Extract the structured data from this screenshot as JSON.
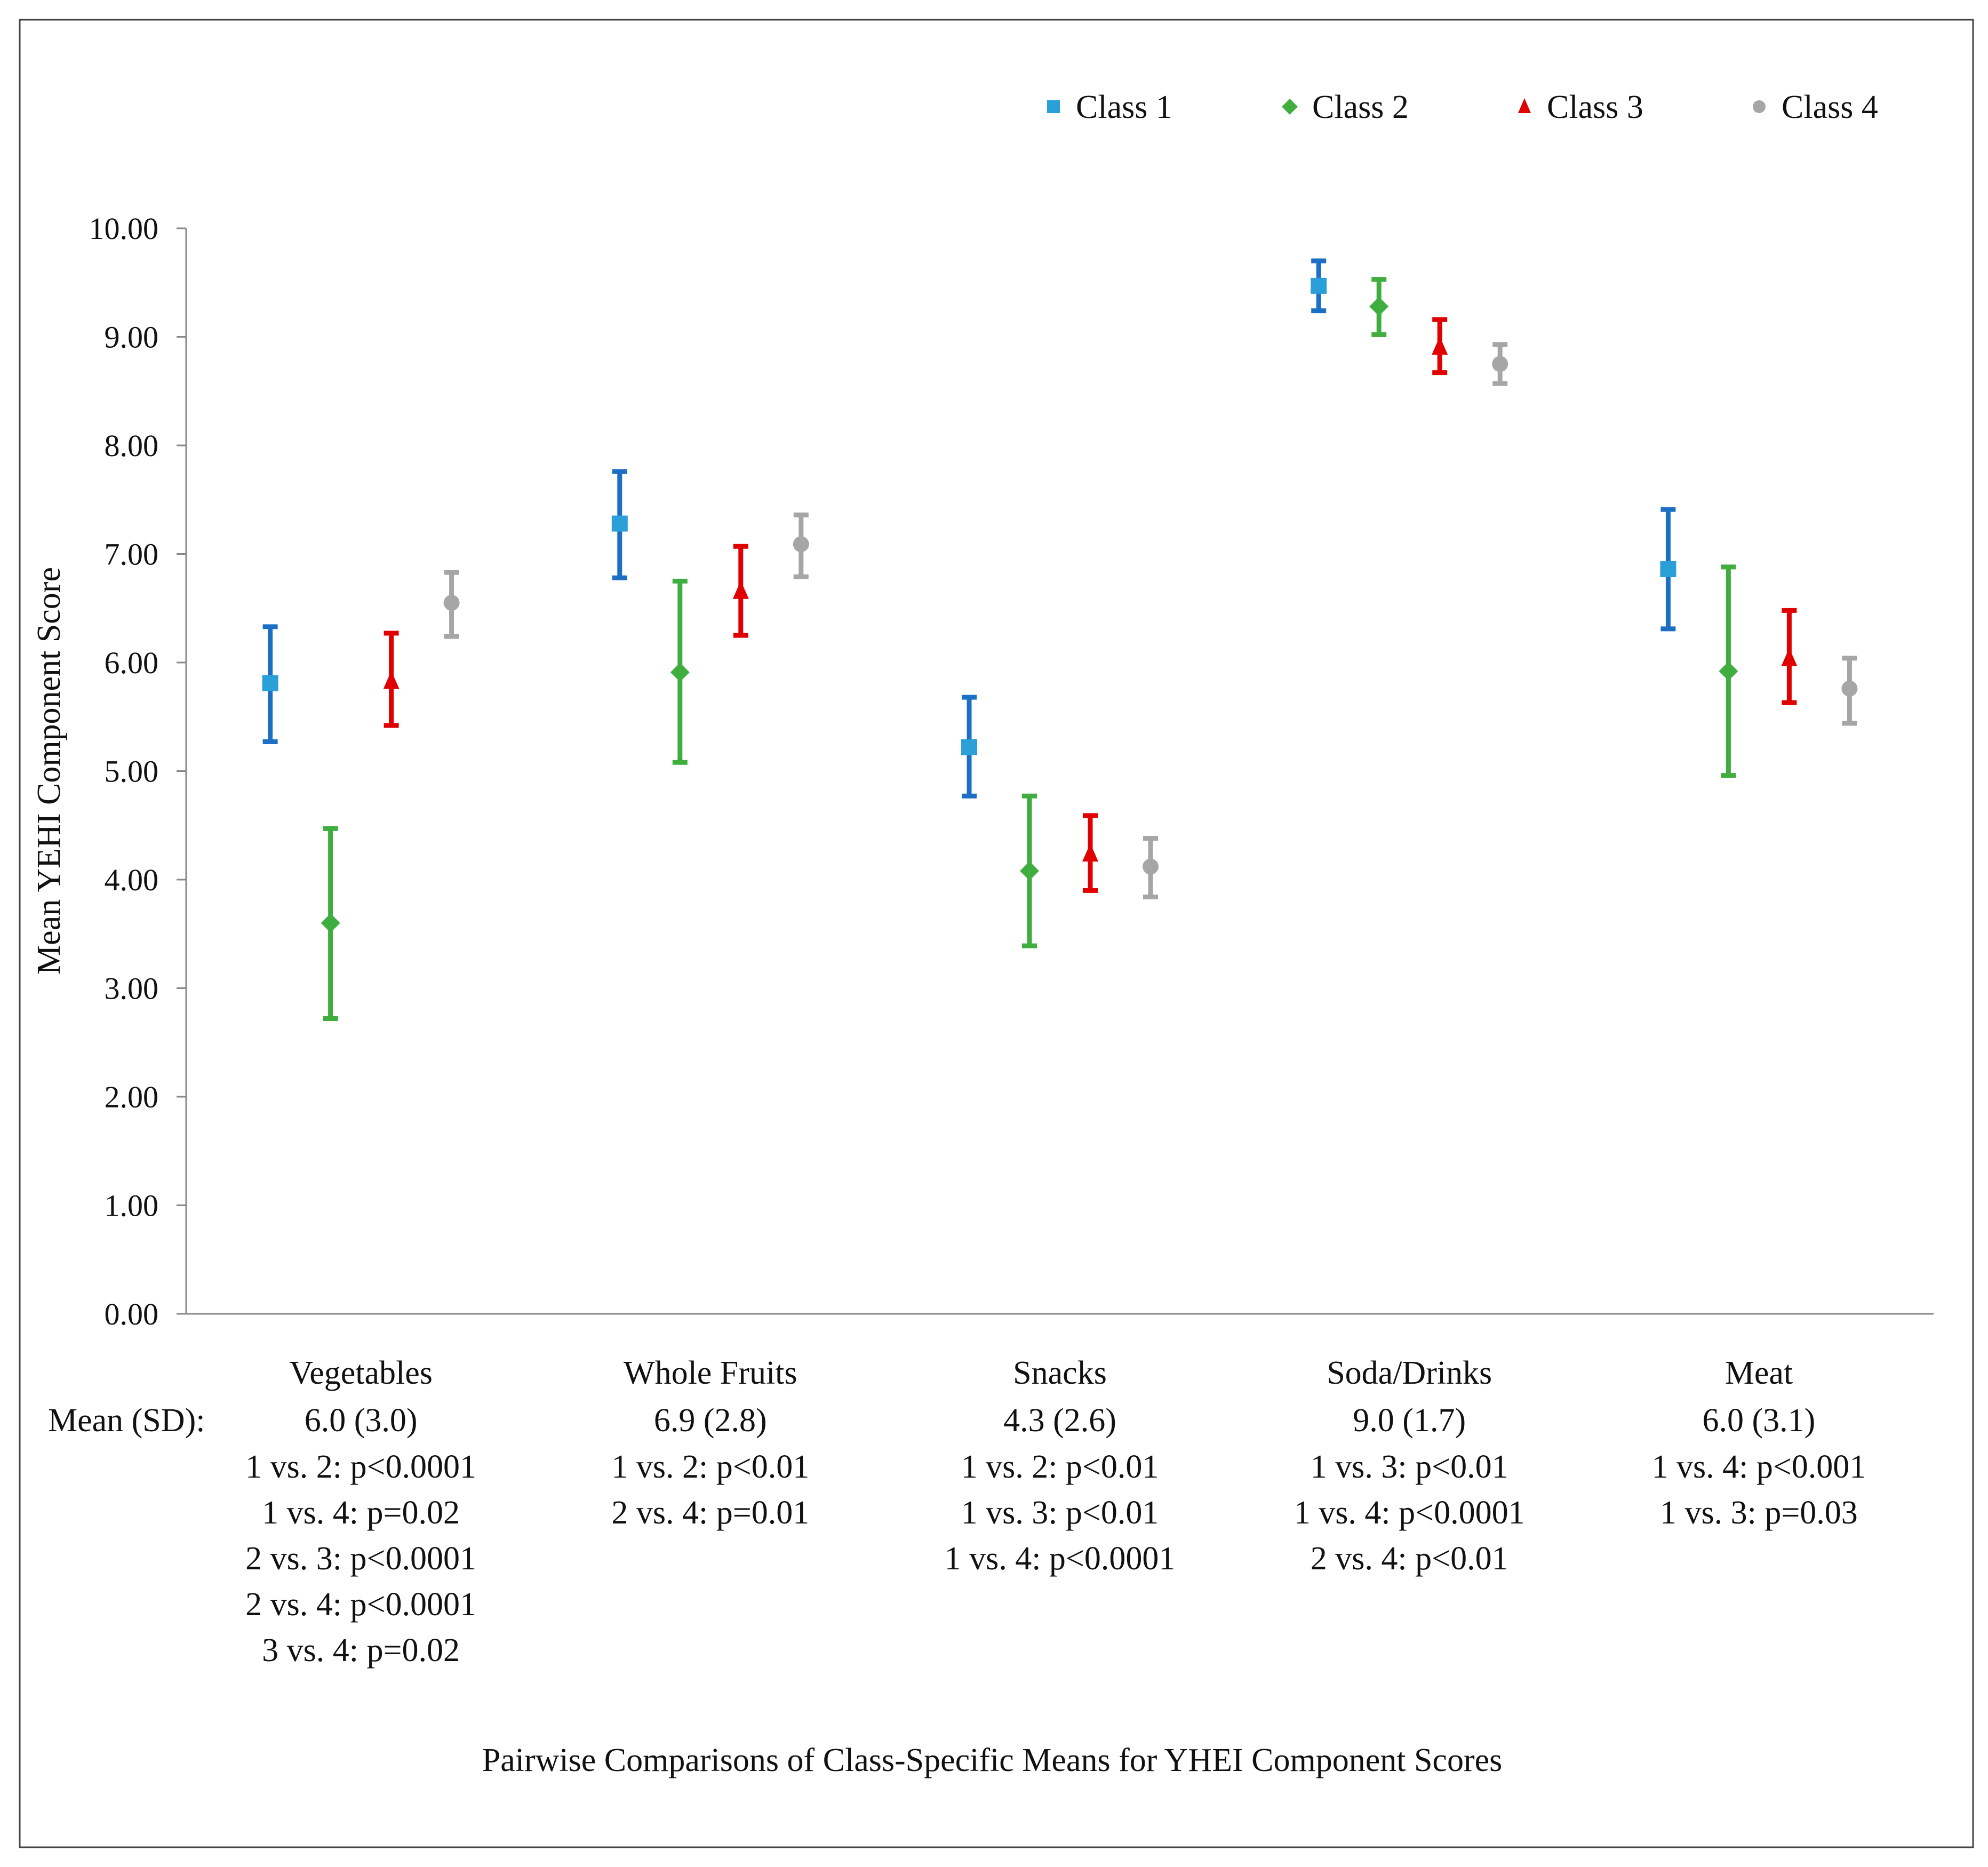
{
  "chart_data": {
    "type": "scatter",
    "subtype": "error-bar",
    "title": "",
    "caption": "Pairwise  Comparisons of Class-Specific Means for YHEI Component Scores",
    "ylabel": "Mean YEHI Component Score",
    "xlabel": "",
    "ylim": [
      0,
      10
    ],
    "yticks": [
      "0.00",
      "1.00",
      "2.00",
      "3.00",
      "4.00",
      "5.00",
      "6.00",
      "7.00",
      "8.00",
      "9.00",
      "10.00"
    ],
    "grid": false,
    "legend_position": "top-right",
    "mean_sd_label": "Mean (SD):",
    "categories": [
      "Vegetables",
      "Whole Fruits",
      "Snacks",
      "Soda/Drinks",
      "Meat"
    ],
    "category_mean_sd": [
      "6.0 (3.0)",
      "6.9 (2.8)",
      "4.3 (2.6)",
      "9.0 (1.7)",
      "6.0 (3.1)"
    ],
    "comparisons": [
      [
        "1 vs. 2: p<0.0001",
        "1 vs. 4: p=0.02",
        "2 vs. 3: p<0.0001",
        "2 vs. 4: p<0.0001",
        "3 vs. 4: p=0.02"
      ],
      [
        "1 vs. 2: p<0.01",
        "2 vs. 4: p=0.01"
      ],
      [
        "1 vs. 2: p<0.01",
        "1 vs. 3: p<0.01",
        "1 vs. 4: p<0.0001"
      ],
      [
        "1 vs. 3: p<0.01",
        "1 vs. 4: p<0.0001",
        "2 vs. 4: p<0.01"
      ],
      [
        "1 vs. 4: p<0.001",
        "1 vs. 3: p=0.03"
      ]
    ],
    "series": [
      {
        "name": "Class 1",
        "marker": "square",
        "color": "#2a9fd8",
        "bar_color": "#1c6fc4",
        "values": [
          5.81,
          7.28,
          5.22,
          9.47,
          6.86
        ],
        "upper": [
          6.33,
          7.76,
          5.68,
          9.7,
          7.41
        ],
        "lower": [
          5.27,
          6.78,
          4.77,
          9.24,
          6.31
        ]
      },
      {
        "name": "Class 2",
        "marker": "diamond",
        "color": "#3fae3f",
        "bar_color": "#3fae3f",
        "values": [
          3.6,
          5.91,
          4.08,
          9.28,
          5.92
        ],
        "upper": [
          4.47,
          6.75,
          4.77,
          9.53,
          6.88
        ],
        "lower": [
          2.72,
          5.08,
          3.39,
          9.02,
          4.96
        ]
      },
      {
        "name": "Class 3",
        "marker": "triangle",
        "color": "#e00000",
        "bar_color": "#e00000",
        "values": [
          5.83,
          6.66,
          4.24,
          8.91,
          6.04
        ],
        "upper": [
          6.27,
          7.07,
          4.59,
          9.16,
          6.48
        ],
        "lower": [
          5.42,
          6.25,
          3.9,
          8.67,
          5.63
        ]
      },
      {
        "name": "Class 4",
        "marker": "circle",
        "color": "#a6a6a6",
        "bar_color": "#a6a6a6",
        "values": [
          6.55,
          7.09,
          4.12,
          8.75,
          5.76
        ],
        "upper": [
          6.83,
          7.36,
          4.38,
          8.93,
          6.04
        ],
        "lower": [
          6.24,
          6.79,
          3.84,
          8.57,
          5.44
        ]
      }
    ]
  }
}
